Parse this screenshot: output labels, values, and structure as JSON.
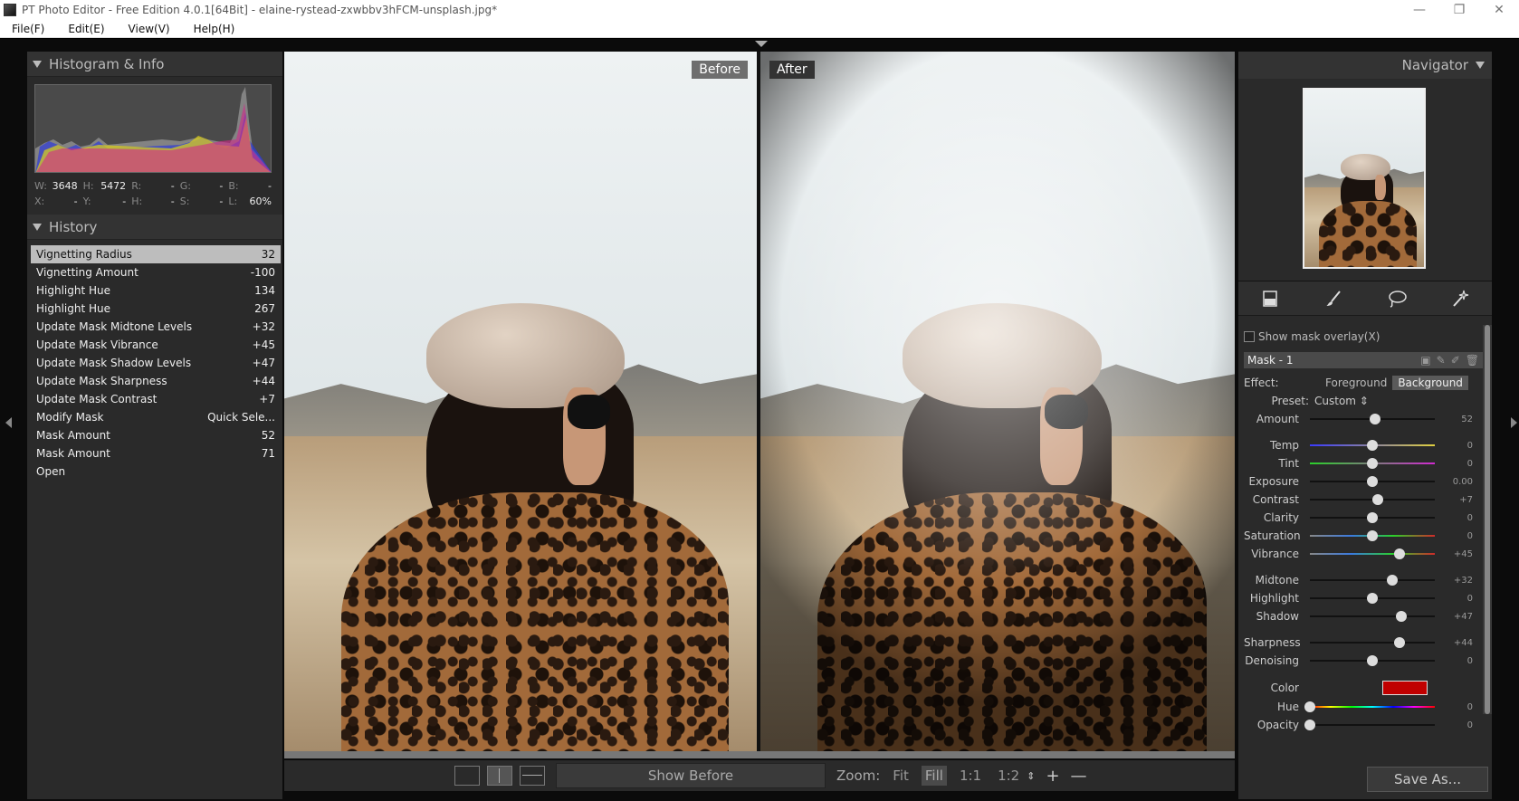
{
  "window": {
    "title": "PT Photo Editor - Free Edition 4.0.1[64Bit] - elaine-rystead-zxwbbv3hFCM-unsplash.jpg*",
    "minimize": "—",
    "restore": "❐",
    "close": "✕"
  },
  "menu": [
    "File(F)",
    "Edit(E)",
    "View(V)",
    "Help(H)"
  ],
  "histogram_panel": {
    "title": "Histogram & Info",
    "info_row1": [
      {
        "label": "W:",
        "value": "3648"
      },
      {
        "label": "H:",
        "value": "5472"
      },
      {
        "label": "R:",
        "value": "-"
      },
      {
        "label": "G:",
        "value": "-"
      },
      {
        "label": "B:",
        "value": "-"
      }
    ],
    "info_row2": [
      {
        "label": "X:",
        "value": "-"
      },
      {
        "label": "Y:",
        "value": "-"
      },
      {
        "label": "H:",
        "value": "-"
      },
      {
        "label": "S:",
        "value": "-"
      },
      {
        "label": "L:",
        "value": "60%"
      }
    ]
  },
  "history_panel": {
    "title": "History",
    "items": [
      {
        "name": "Vignetting Radius",
        "value": "32"
      },
      {
        "name": "Vignetting Amount",
        "value": "-100"
      },
      {
        "name": "Highlight Hue",
        "value": "134"
      },
      {
        "name": "Highlight Hue",
        "value": "267"
      },
      {
        "name": "Update Mask Midtone Levels",
        "value": "+32"
      },
      {
        "name": "Update Mask Vibrance",
        "value": "+45"
      },
      {
        "name": "Update Mask Shadow Levels",
        "value": "+47"
      },
      {
        "name": "Update Mask Sharpness",
        "value": "+44"
      },
      {
        "name": "Update Mask Contrast",
        "value": "+7"
      },
      {
        "name": "Modify Mask",
        "value": "Quick Sele..."
      },
      {
        "name": "Mask Amount",
        "value": "52"
      },
      {
        "name": "Mask Amount",
        "value": "71"
      },
      {
        "name": "Open",
        "value": ""
      }
    ]
  },
  "compare": {
    "before_label": "Before",
    "after_label": "After"
  },
  "bottom_bar": {
    "show_before": "Show Before",
    "zoom_label": "Zoom:",
    "zoom_fit": "Fit",
    "zoom_fill": "Fill",
    "zoom_1_1": "1:1",
    "zoom_1_2": "1:2",
    "zoom_in": "+",
    "zoom_out": "—"
  },
  "navigator": {
    "title": "Navigator"
  },
  "mask_panel": {
    "show_overlay": "Show mask overlay(X)",
    "mask_name": "Mask - 1",
    "effect_label": "Effect:",
    "effect_foreground": "Foreground",
    "effect_background": "Background",
    "preset_label": "Preset:",
    "preset_value": "Custom ⇕",
    "color_label": "Color",
    "color_value": "#c00000"
  },
  "sliders": [
    {
      "label": "Amount",
      "value": "52",
      "pos": 0.52,
      "track": "plain"
    },
    {
      "label": "Temp",
      "value": "0",
      "pos": 0.5,
      "track": "temp",
      "gap": true
    },
    {
      "label": "Tint",
      "value": "0",
      "pos": 0.5,
      "track": "tint"
    },
    {
      "label": "Exposure",
      "value": "0.00",
      "pos": 0.5,
      "track": "plain"
    },
    {
      "label": "Contrast",
      "value": "+7",
      "pos": 0.54,
      "track": "plain"
    },
    {
      "label": "Clarity",
      "value": "0",
      "pos": 0.5,
      "track": "plain"
    },
    {
      "label": "Saturation",
      "value": "0",
      "pos": 0.5,
      "track": "sat"
    },
    {
      "label": "Vibrance",
      "value": "+45",
      "pos": 0.72,
      "track": "sat"
    },
    {
      "label": "Midtone",
      "value": "+32",
      "pos": 0.66,
      "track": "plain",
      "gap": true
    },
    {
      "label": "Highlight",
      "value": "0",
      "pos": 0.5,
      "track": "plain"
    },
    {
      "label": "Shadow",
      "value": "+47",
      "pos": 0.73,
      "track": "plain"
    },
    {
      "label": "Sharpness",
      "value": "+44",
      "pos": 0.72,
      "track": "plain",
      "gap": true
    },
    {
      "label": "Denoising",
      "value": "0",
      "pos": 0.5,
      "track": "plain"
    }
  ],
  "color_sliders": [
    {
      "label": "Hue",
      "value": "0",
      "pos": 0.0,
      "track": "hue"
    },
    {
      "label": "Opacity",
      "value": "0",
      "pos": 0.0,
      "track": "plain"
    }
  ],
  "save_button": "Save As..."
}
